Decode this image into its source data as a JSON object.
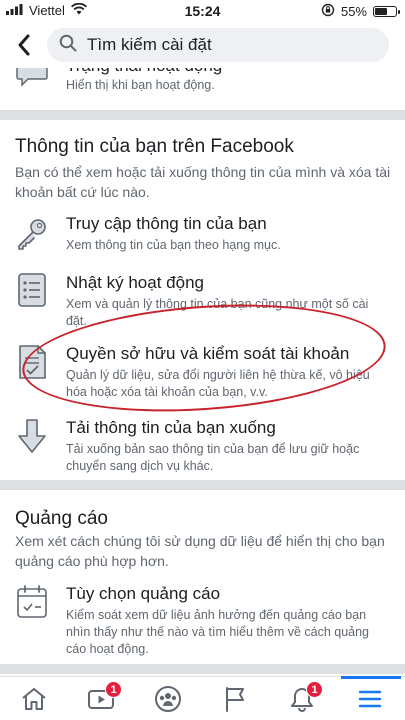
{
  "status_bar": {
    "carrier": "Viettel",
    "time": "15:24",
    "battery": "55%"
  },
  "search": {
    "placeholder": "Tìm kiếm cài đặt"
  },
  "top_item": {
    "title": "Trạng thái hoạt động",
    "desc": "Hiển thị khi bạn hoạt động."
  },
  "section_info": {
    "title": "Thông tin của bạn trên Facebook",
    "desc": "Bạn có thể xem hoặc tải xuống thông tin của mình và xóa tài khoản bất cứ lúc nào.",
    "items": [
      {
        "title": "Truy cập thông tin của bạn",
        "desc": "Xem thông tin của bạn theo hạng mục."
      },
      {
        "title": "Nhật ký hoạt động",
        "desc": "Xem và quản lý thông tin của bạn cũng như một số cài đặt."
      },
      {
        "title": "Quyền sở hữu và kiểm soát tài khoản",
        "desc": "Quản lý dữ liệu, sửa đổi người liên hệ thừa kế, vô hiệu hóa hoặc xóa tài khoản của bạn, v.v."
      },
      {
        "title": "Tải thông tin của bạn xuống",
        "desc": "Tải xuống bản sao thông tin của bạn để lưu giữ hoặc chuyển sang dịch vụ khác."
      }
    ]
  },
  "section_ads": {
    "title": "Quảng cáo",
    "desc": "Xem xét cách chúng tôi sử dụng dữ liệu để hiển thị cho bạn quảng cáo phù hợp hơn.",
    "items": [
      {
        "title": "Tùy chọn quảng cáo",
        "desc": "Kiểm soát xem dữ liệu ảnh hưởng đến quảng cáo bạn nhìn thấy như thế nào và tìm hiểu thêm về cách quảng cáo hoạt động."
      }
    ]
  },
  "bottom_nav": {
    "video_badge": "1",
    "notifications_badge": "1"
  },
  "colors": {
    "accent": "#1877f2",
    "badge": "#e41e3f",
    "annotation": "#c8232c"
  }
}
